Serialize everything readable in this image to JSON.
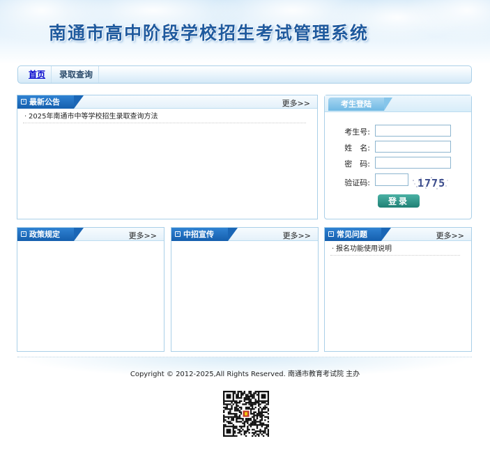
{
  "header": {
    "title": "南通市高中阶段学校招生考试管理系统"
  },
  "nav": {
    "items": [
      {
        "label": "首页"
      },
      {
        "label": "录取查询"
      }
    ]
  },
  "announcements": {
    "title": "最新公告",
    "more": "更多>>",
    "items": [
      "2025年南通市中等学校招生录取查询方法"
    ]
  },
  "login": {
    "title": "考生登陆",
    "exam_no_label": "考生号:",
    "name_label": "姓　名:",
    "password_label": "密　码:",
    "captcha_label": "验证码:",
    "captcha_code": "1775",
    "exam_no_value": "",
    "name_value": "",
    "password_value": "",
    "captcha_value": "",
    "submit": "登录"
  },
  "policy": {
    "title": "政策规定",
    "more": "更多>>",
    "items": []
  },
  "promo": {
    "title": "中招宣传",
    "more": "更多>>",
    "items": []
  },
  "faq": {
    "title": "常见问题",
    "more": "更多>>",
    "items": [
      "报名功能使用说明"
    ]
  },
  "footer": {
    "copyright": "Copyright © 2012-2025,All Rights Reserved. 南通市教育考试院 主办"
  },
  "colors": {
    "brand_blue": "#155fae",
    "border": "#a9cfe8",
    "login_button": "#1f8074",
    "title_blue": "#1f5a9e"
  }
}
